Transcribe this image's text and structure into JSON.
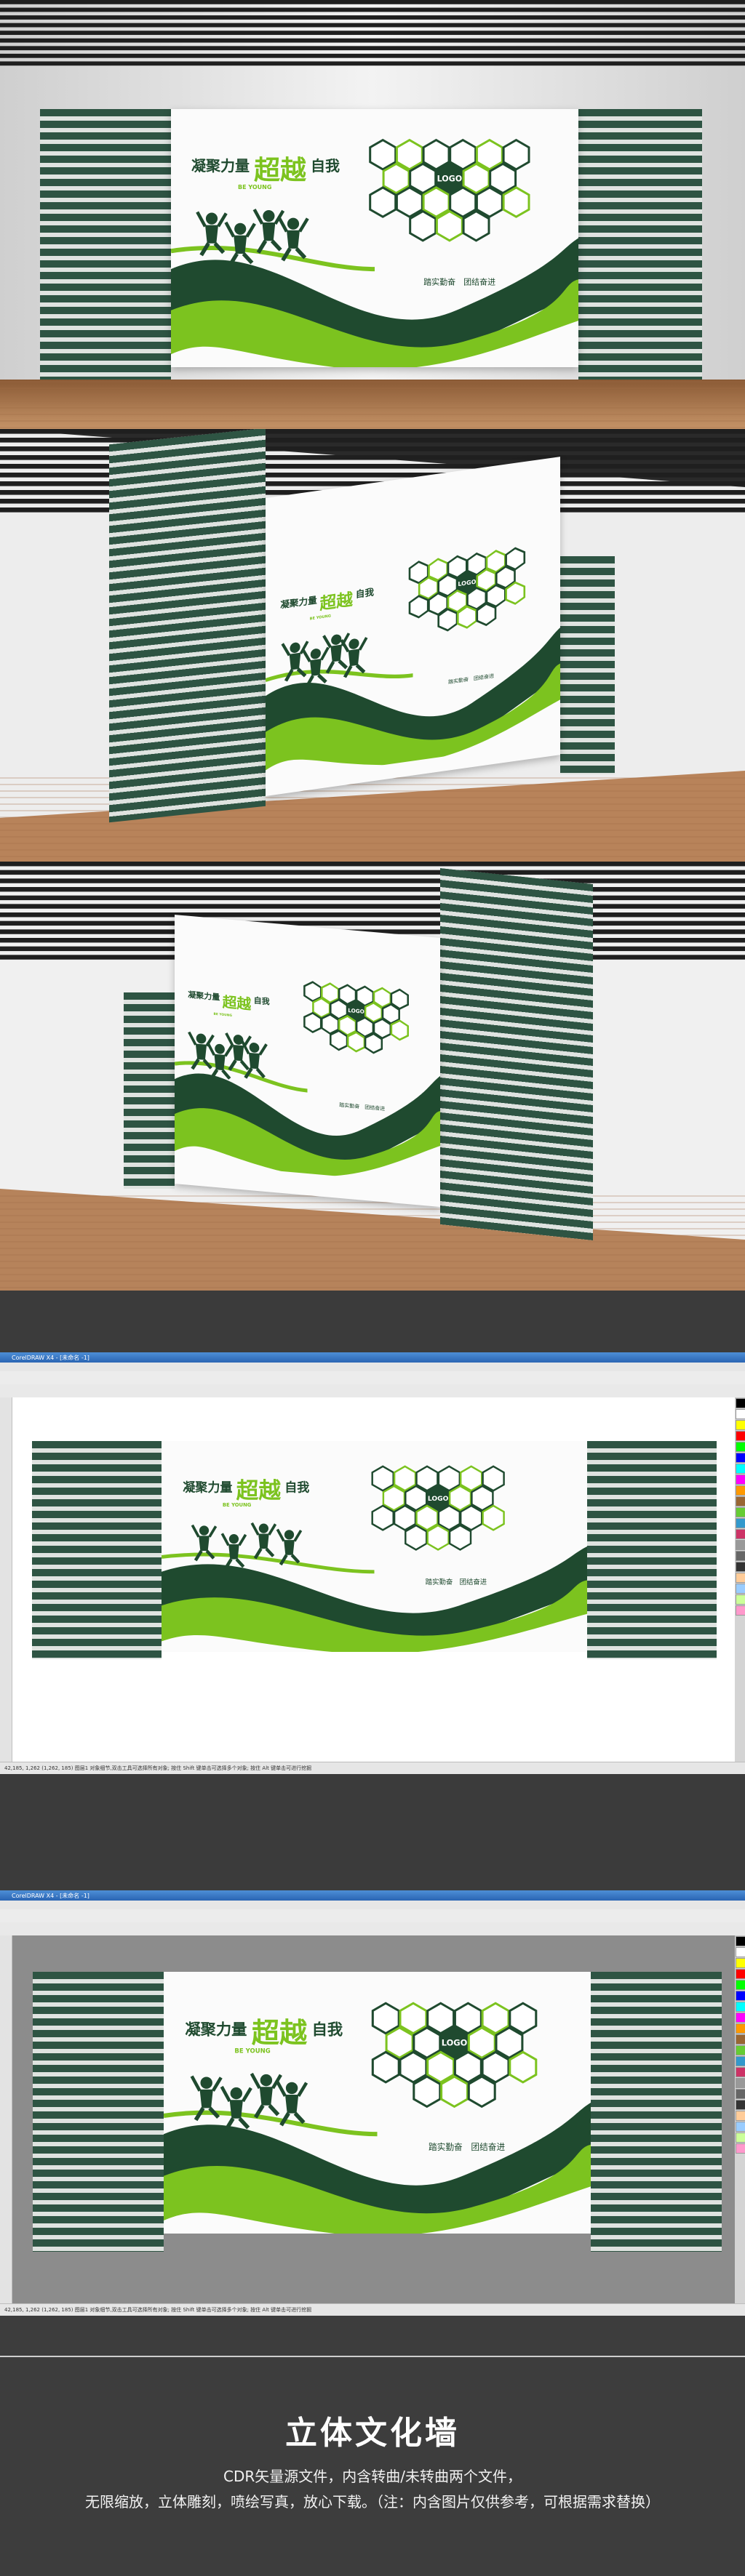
{
  "wall": {
    "slogan_left": "凝聚力量",
    "slogan_big": "超越",
    "slogan_right": "自我",
    "slogan_sub": "BE YOUNG",
    "logo": "LOGO",
    "tagline": "踏实勤奋　团结奋进"
  },
  "cdr": {
    "title": "CorelDRAW X4 - [未命名 -1]",
    "status": "42,185, 1,262  (1,262, 185) 图层1 对象细节,双击工具可选择所有对象; 按住 Shift 键单击可选择多个对象; 按住 Alt 键单击可进行挖掘"
  },
  "footer": {
    "title": "立体文化墙",
    "line1": "CDR矢量源文件，内含转曲/未转曲两个文件，",
    "line2": "无限缩放，立体雕刻，喷绘写真，放心下载。（注：内含图片仅供参考，可根据需求替换）"
  },
  "colors": {
    "dark_green": "#1f4a2f",
    "light_green": "#7cc31f",
    "stripe": "#2e5443"
  }
}
